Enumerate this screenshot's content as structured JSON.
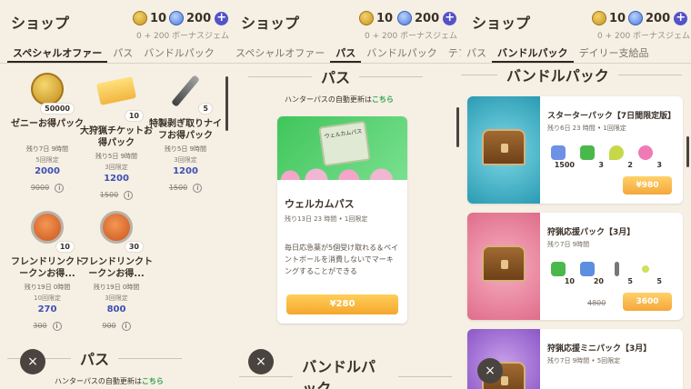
{
  "shop_title": "ショップ",
  "coins": "10",
  "gems": "200",
  "bonus": "0 + 200 ボーナスジェム",
  "tabs": {
    "special": "スペシャルオファー",
    "pass": "パス",
    "bundle": "バンドルパック",
    "defer": "テファー",
    "daily": "デイリー支給品"
  },
  "pass_section": "パス",
  "bundle_section": "バンドルパック",
  "auto_update": {
    "text": "ハンターパスの自動更新は",
    "link": "こちら"
  },
  "items": [
    {
      "name": "ゼニーお得パック",
      "qty": "50000",
      "time": "残り7日 9時間",
      "limit": "5回限定",
      "price": "2000",
      "old": "9000"
    },
    {
      "name": "大狩猟チケットお得パック",
      "qty": "10",
      "time": "残り5日 9時間",
      "limit": "3回限定",
      "price": "1200",
      "old": "1500"
    },
    {
      "name": "特製剥ぎ取りナイフお得パック",
      "qty": "5",
      "time": "残り5日 9時間",
      "limit": "3回限定",
      "price": "1200",
      "old": "1500"
    },
    {
      "name": "フレンドリンクトークンお得...",
      "qty": "10",
      "time": "残り19日 0時間",
      "limit": "10回限定",
      "price": "270",
      "old": "300"
    },
    {
      "name": "フレンドリンクトークンお得...",
      "qty": "30",
      "time": "残り19日 0時間",
      "limit": "3回限定",
      "price": "800",
      "old": "900"
    }
  ],
  "welcome_pass": {
    "name": "ウェルカムパス",
    "image_label": "ウェルカムパス",
    "time": "残り13日 23 時間",
    "limit": "1回限定",
    "desc": "毎日応急薬が5個受け取れる＆ペイントボールを消費しないでマーキングすることができる",
    "price": "¥280"
  },
  "bundles": [
    {
      "name": "スターターパック【7日間限定版】",
      "time": "残り6日 23 時間",
      "limit": "1回限定",
      "items": [
        "1500",
        "3",
        "2",
        "3"
      ],
      "price": "¥980"
    },
    {
      "name": "狩猟応援パック【3月】",
      "time": "残り7日 9時間",
      "items": [
        "10",
        "20",
        "5",
        "5"
      ],
      "old": "4800",
      "price": "3600"
    },
    {
      "name": "狩猟応援ミニパック【3月】",
      "time": "残り7日 9時間",
      "limit": "5回限定"
    }
  ],
  "close": "×",
  "info": "i"
}
